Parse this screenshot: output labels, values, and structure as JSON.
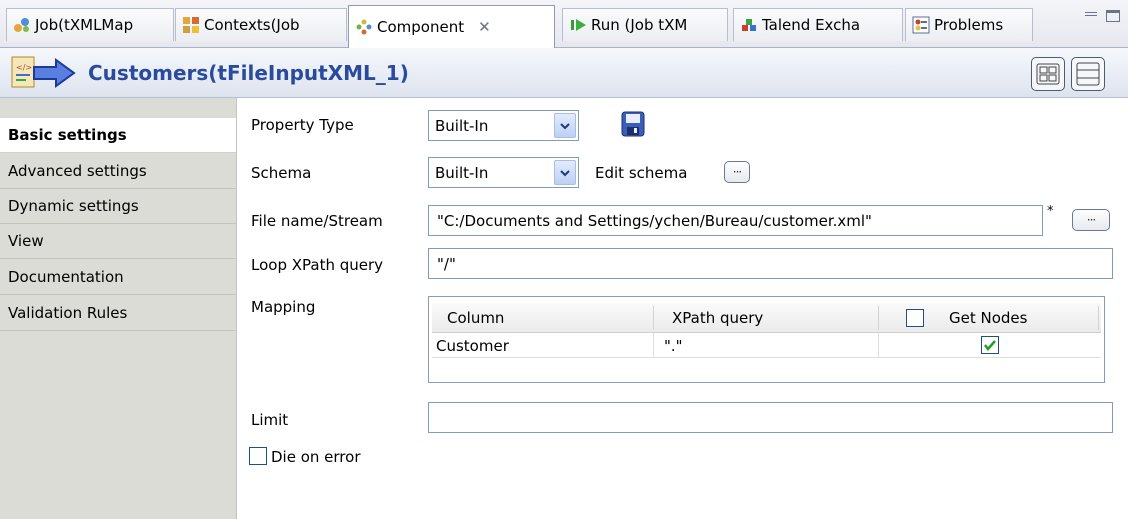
{
  "tabs": [
    {
      "label": "Job(tXMLMap",
      "icon": "job-icon"
    },
    {
      "label": "Contexts(Job",
      "icon": "contexts-icon"
    },
    {
      "label": "Component",
      "icon": "component-icon",
      "active": true,
      "close": "✕"
    },
    {
      "label": "Run (Job tXM",
      "icon": "run-icon"
    },
    {
      "label": "Talend Excha",
      "icon": "exchange-icon"
    },
    {
      "label": "Problems",
      "icon": "problems-icon"
    }
  ],
  "title": "Customers(tFileInputXML_1)",
  "nav": [
    {
      "label": "Basic settings",
      "selected": true
    },
    {
      "label": "Advanced settings"
    },
    {
      "label": "Dynamic settings"
    },
    {
      "label": "View"
    },
    {
      "label": "Documentation"
    },
    {
      "label": "Validation Rules"
    }
  ],
  "form": {
    "property_type_label": "Property Type",
    "property_type_value": "Built-In",
    "schema_label": "Schema",
    "schema_value": "Built-In",
    "edit_schema_label": "Edit schema",
    "file_label": "File name/Stream",
    "file_value": "\"C:/Documents and Settings/ychen/Bureau/customer.xml\"",
    "file_required_mark": "*",
    "loop_label": "Loop XPath query",
    "loop_value": "\"/\"",
    "mapping_label": "Mapping",
    "limit_label": "Limit",
    "limit_value": "",
    "die_on_error_label": "Die on error"
  },
  "mapping": {
    "headers": {
      "column": "Column",
      "xpath": "XPath query",
      "get_nodes": "Get Nodes"
    },
    "rows": [
      {
        "column": "Customer",
        "xpath": "\".\"",
        "get_nodes": true
      }
    ]
  },
  "dots": "···",
  "colors": {
    "title": "#2a4a9e",
    "nav_bg": "#dcdcd7",
    "border": "#7f9db9"
  }
}
